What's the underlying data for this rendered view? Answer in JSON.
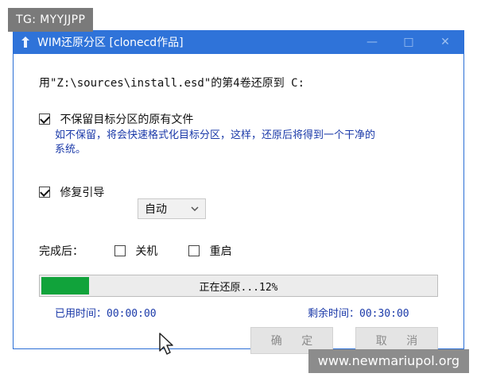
{
  "overlay": {
    "tg_label": "TG: MYYJJPP",
    "watermark": "www.newmariupol.org"
  },
  "window": {
    "title": "WIM还原分区 [clonecd作品]",
    "controls": {
      "minimize": "—",
      "maximize": "□",
      "close": "✕"
    }
  },
  "dialog": {
    "restore_line": "用\"Z:\\sources\\install.esd\"的第4卷还原到 C:",
    "keep_files_label": "不保留目标分区的原有文件",
    "keep_files_note_1": "如不保留，将会快速格式化目标分区，这样，还原后将得到一个干净的",
    "keep_files_note_2": "系统。",
    "repair_boot_label": "修复引导",
    "repair_boot_select_value": "自动",
    "after_label": "完成后：",
    "shutdown_label": "关机",
    "restart_label": "重启",
    "progress": {
      "text": "正在还原...12%",
      "value": 0.12
    },
    "elapsed": "已用时间：00:00:00",
    "remaining": "剩余时间：00:30:00",
    "ok_button": "确 定",
    "cancel_button": "取 消"
  },
  "state": {
    "keep_files_checked": true,
    "repair_boot_checked": true,
    "shutdown_checked": false,
    "restart_checked": false
  },
  "colors": {
    "titlebar": "#2f73d9",
    "note_text": "#1b3aa9",
    "progress_fill": "#11a33b"
  }
}
